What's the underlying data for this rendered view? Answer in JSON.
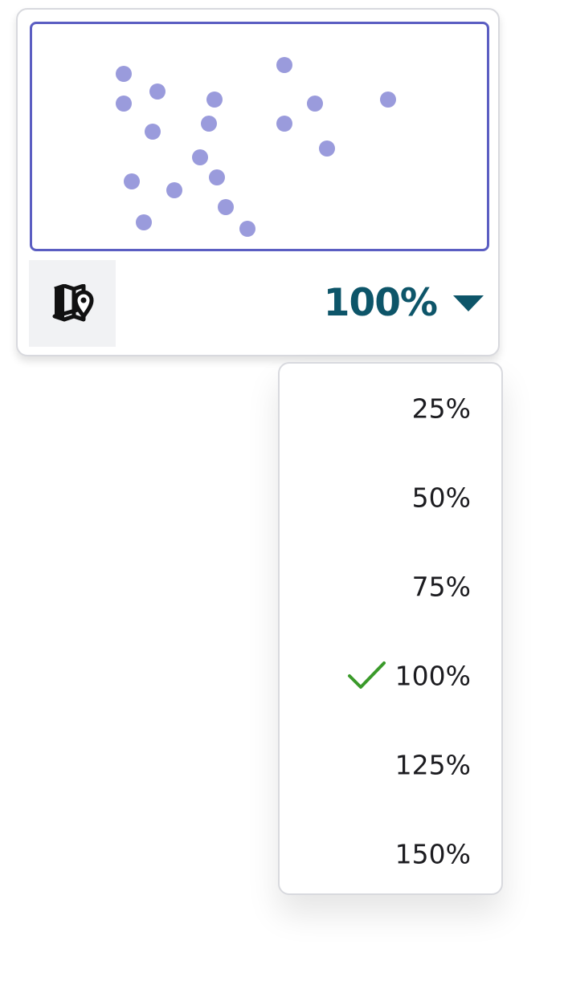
{
  "minimap": {
    "viewport_color": "#5b5ec2",
    "dot_color": "#9a9bdc",
    "map_icon": "map-pin-icon"
  },
  "zoom": {
    "current": "100%",
    "text_color": "#0d5569",
    "options": [
      {
        "label": "25%",
        "selected": false
      },
      {
        "label": "50%",
        "selected": false
      },
      {
        "label": "75%",
        "selected": false
      },
      {
        "label": "100%",
        "selected": true
      },
      {
        "label": "125%",
        "selected": false
      },
      {
        "label": "150%",
        "selected": false
      }
    ],
    "check_icon": "check-icon",
    "check_color": "#3a9a2a"
  }
}
